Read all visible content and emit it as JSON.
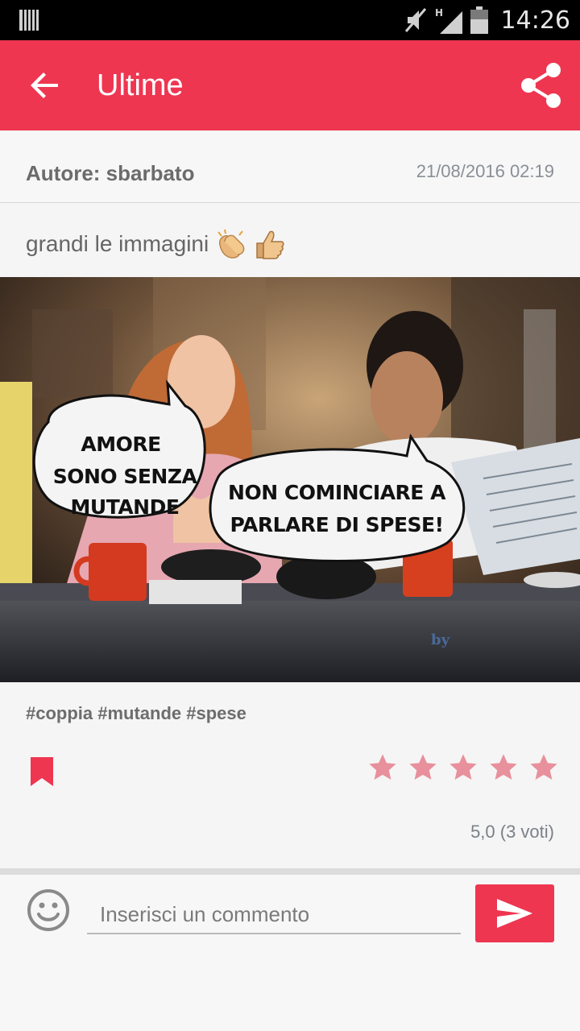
{
  "status_bar": {
    "time": "14:26",
    "network": "H",
    "icons": [
      "sim-icon",
      "mute-icon",
      "signal-icon",
      "battery-icon"
    ]
  },
  "app_bar": {
    "title": "Ultime",
    "back_icon": "arrow-back-icon",
    "share_icon": "share-icon",
    "color": "#ee3651"
  },
  "post": {
    "author": "Autore: sbarbato",
    "date": "21/08/2016 02:19",
    "text": "grandi le immagini",
    "text_emojis": [
      "clapping-hands-icon",
      "thumbs-up-icon"
    ],
    "image": {
      "bubble_left": [
        "AMORE",
        "SONO SENZA",
        "MUTANDE"
      ],
      "bubble_right": [
        "NON COMINCIARE A",
        "PARLARE DI SPESE!"
      ],
      "watermark": "by"
    },
    "hashtags": "#coppia #mutande #spese",
    "rating": {
      "value": 5.0,
      "max": 5,
      "label": "5,0 (3 voti)",
      "star_color": "#e8909c"
    },
    "bookmark_color": "#ee3651"
  },
  "comment_box": {
    "placeholder": "Inserisci un commento",
    "emoji_icon": "smiley-icon",
    "send_icon": "send-icon"
  }
}
